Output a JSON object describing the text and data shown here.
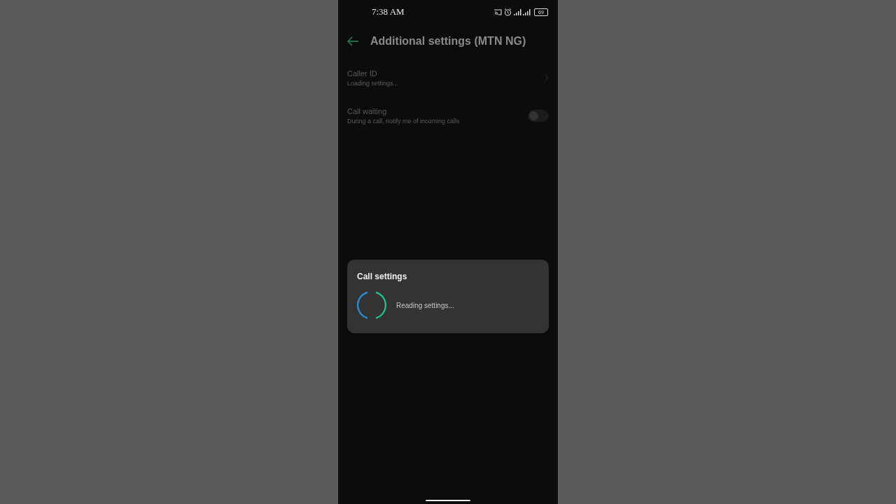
{
  "status_bar": {
    "time": "7:38 AM",
    "battery": "69"
  },
  "header": {
    "title": "Additional settings (MTN NG)"
  },
  "settings": [
    {
      "kind": "link",
      "title": "Caller ID",
      "summary": "Loading settings..."
    },
    {
      "kind": "toggle",
      "title": "Call waiting",
      "summary": "During a call, notify me of incoming calls",
      "on": false
    }
  ],
  "dialog": {
    "title": "Call settings",
    "message": "Reading settings..."
  }
}
